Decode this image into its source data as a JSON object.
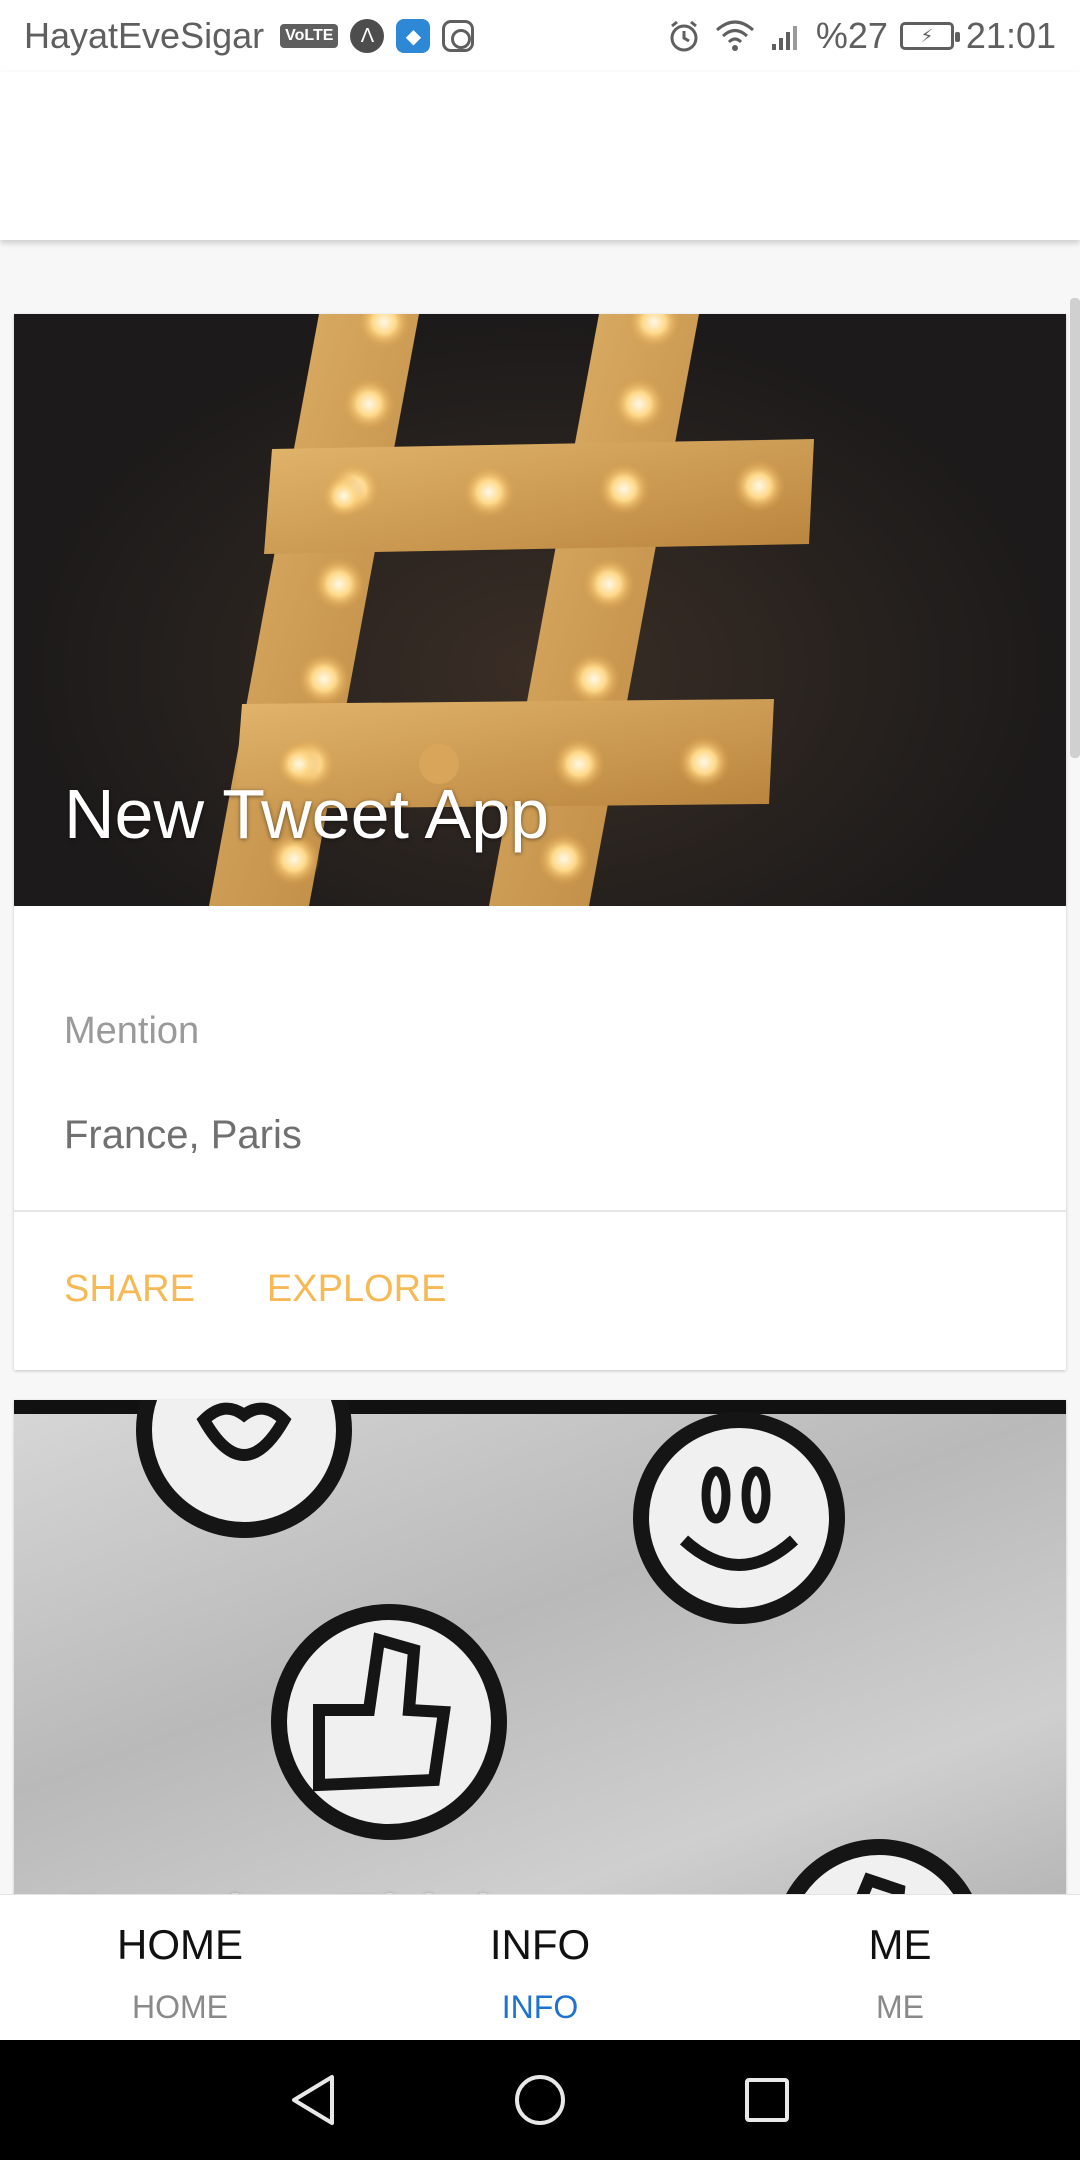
{
  "status_bar": {
    "carrier": "HayatEveSigar",
    "volte": "VoLTE",
    "battery_text": "%27",
    "time": "21:01",
    "icons": [
      "volte-icon",
      "app-a-icon",
      "shield-icon",
      "instagram-icon",
      "alarm-icon",
      "wifi-icon",
      "signal-icon",
      "battery-icon"
    ]
  },
  "cards": [
    {
      "title": "New Tweet App",
      "subtitle": "Mention",
      "location": "France, Paris",
      "actions": [
        "SHARE",
        "EXPLORE"
      ],
      "image": "hashtag-marquee-lights"
    },
    {
      "title": "Develop Think",
      "image": "smiley-thumbs-up-wall"
    }
  ],
  "tabs": [
    {
      "title": "HOME",
      "label": "HOME",
      "active": false
    },
    {
      "title": "INFO",
      "label": "INFO",
      "active": true
    },
    {
      "title": "ME",
      "label": "ME",
      "active": false
    }
  ],
  "colors": {
    "accent": "#f5b955",
    "active_tab": "#1e73d2",
    "inactive_tab": "#8a8a8a"
  },
  "nav": [
    "back-icon",
    "home-icon",
    "recents-icon"
  ]
}
